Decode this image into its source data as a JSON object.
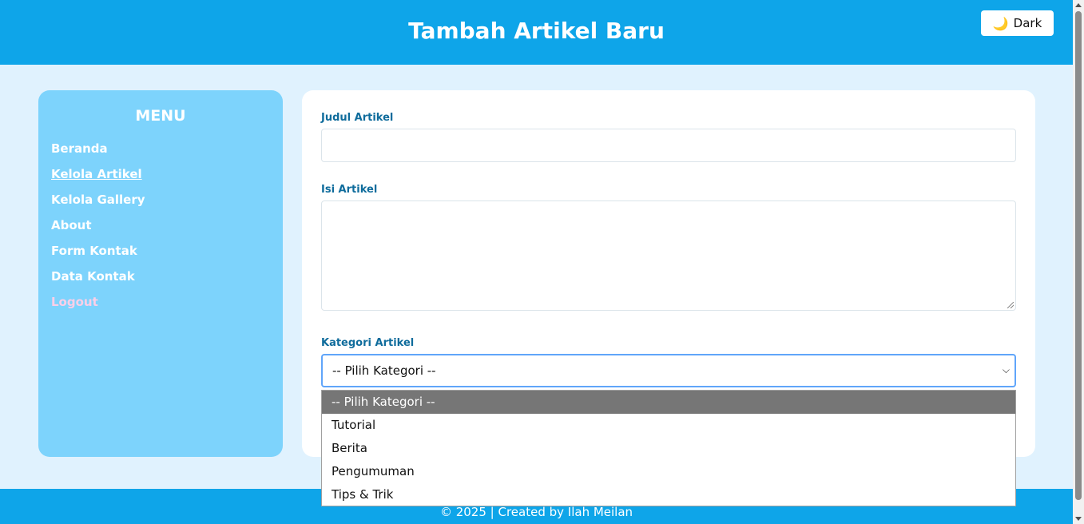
{
  "header": {
    "title": "Tambah Artikel Baru",
    "theme_toggle": {
      "icon": "moon-icon",
      "glyph": "🌙",
      "label": "Dark"
    }
  },
  "sidebar": {
    "title": "MENU",
    "items": [
      {
        "label": "Beranda",
        "active": false
      },
      {
        "label": "Kelola Artikel",
        "active": true
      },
      {
        "label": "Kelola Gallery",
        "active": false
      },
      {
        "label": "About",
        "active": false
      },
      {
        "label": "Form Kontak",
        "active": false
      },
      {
        "label": "Data Kontak",
        "active": false
      },
      {
        "label": "Logout",
        "active": false
      }
    ]
  },
  "form": {
    "title_label": "Judul Artikel",
    "title_value": "",
    "content_label": "Isi Artikel",
    "content_value": "",
    "category_label": "Kategori Artikel",
    "category_selected": "-- Pilih Kategori --",
    "category_options": [
      "-- Pilih Kategori --",
      "Tutorial",
      "Berita",
      "Pengumuman",
      "Tips & Trik"
    ]
  },
  "footer": {
    "text": "© 2025 | Created by Ilah Meilan"
  },
  "colors": {
    "header_bg": "#0ea5e9",
    "sidebar_bg": "#7dd3fc",
    "page_bg": "#e0f2fe",
    "label_color": "#0f6c9c",
    "logout_color": "#fbcfe8",
    "selected_option_bg": "#767676"
  }
}
